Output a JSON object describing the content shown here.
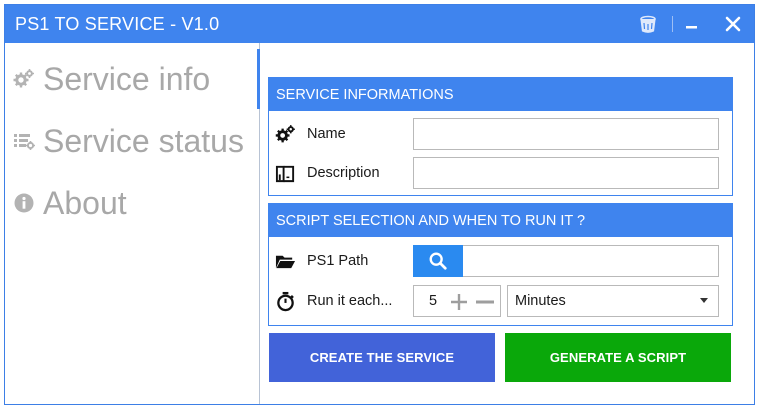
{
  "window": {
    "title": "PS1 TO SERVICE - V1.0"
  },
  "colors": {
    "titlebar": "#3f84ee",
    "create_button": "#4263d9",
    "generate_button": "#0aa80a",
    "search_button": "#2a8af0"
  },
  "titlebar_buttons": [
    {
      "icon": "bucket-icon"
    },
    {
      "icon": "minimize-icon"
    },
    {
      "icon": "close-icon"
    }
  ],
  "sidebar": {
    "items": [
      {
        "label": "Service info",
        "icon": "gears-icon",
        "active": true
      },
      {
        "label": "Service status",
        "icon": "list-gear-icon",
        "active": false
      },
      {
        "label": "About",
        "icon": "info-icon",
        "active": false
      }
    ]
  },
  "service_panel": {
    "header": "SERVICE INFORMATIONS",
    "name_label": "Name",
    "name_value": "",
    "description_label": "Description",
    "description_value": ""
  },
  "script_panel": {
    "header": "SCRIPT SELECTION AND WHEN TO RUN IT ?",
    "path_label": "PS1 Path",
    "path_value": "",
    "interval_label": "Run it each...",
    "interval_value": "5",
    "unit_selected": "Minutes"
  },
  "actions": {
    "create_label": "CREATE THE SERVICE",
    "generate_label": "GENERATE A SCRIPT"
  }
}
